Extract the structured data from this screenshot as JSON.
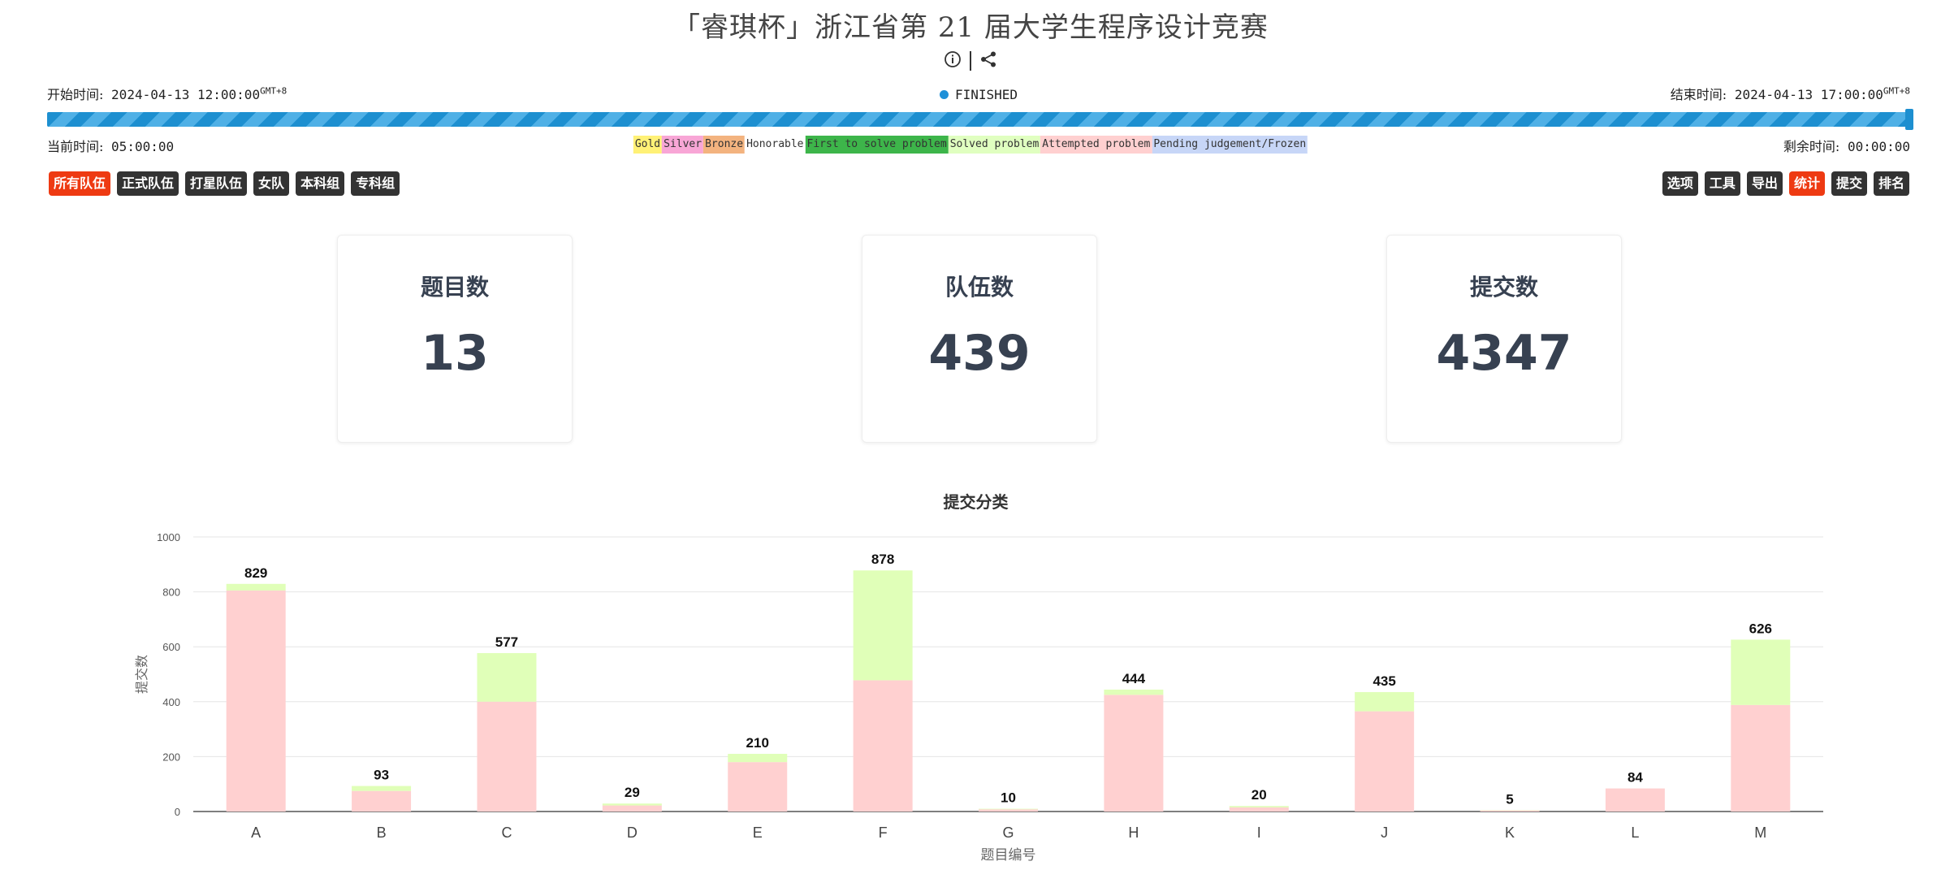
{
  "header": {
    "title": "「睿琪杯」浙江省第 21 届大学生程序设计竞赛",
    "info_icon": "info-circle-icon",
    "share_icon": "share-icon"
  },
  "times": {
    "start_label": "开始时间:",
    "start_value": "2024-04-13 12:00:00",
    "start_tz": "GMT+8",
    "end_label": "结束时间:",
    "end_value": "2024-04-13 17:00:00",
    "end_tz": "GMT+8",
    "status": "FINISHED",
    "current_label": "当前时间:",
    "current_value": "05:00:00",
    "remaining_label": "剩余时间:",
    "remaining_value": "00:00:00",
    "progress_fraction": 1.0
  },
  "legend": [
    {
      "label": "Gold",
      "color": "#fff176"
    },
    {
      "label": "Silver",
      "color": "#f8a6d6"
    },
    {
      "label": "Bronze",
      "color": "#f3b37f"
    },
    {
      "label": "Honorable",
      "color": "#ffffff"
    },
    {
      "label": "First to solve problem",
      "color": "#3db54a"
    },
    {
      "label": "Solved problem",
      "color": "#e0ffc0"
    },
    {
      "label": "Attempted problem",
      "color": "#ffd0d0"
    },
    {
      "label": "Pending judgement/Frozen",
      "color": "#c7d6f7"
    }
  ],
  "filters": [
    "所有队伍",
    "正式队伍",
    "打星队伍",
    "女队",
    "本科组",
    "专科组"
  ],
  "filters_active": 0,
  "tools": [
    "选项",
    "工具",
    "导出",
    "统计",
    "提交",
    "排名"
  ],
  "tools_active": 3,
  "stats": [
    {
      "label": "题目数",
      "value": "13"
    },
    {
      "label": "队伍数",
      "value": "439"
    },
    {
      "label": "提交数",
      "value": "4347"
    }
  ],
  "colors": {
    "accepted": "#e0ffb8",
    "rejected": "#ffd0d0",
    "active_button": "#ee3a12"
  },
  "chart_data": {
    "type": "bar",
    "title": "提交分类",
    "xlabel": "题目编号",
    "ylabel": "提交数",
    "ylim": [
      0,
      1000
    ],
    "yticks": [
      0,
      200,
      400,
      600,
      800,
      1000
    ],
    "categories": [
      "A",
      "B",
      "C",
      "D",
      "E",
      "F",
      "G",
      "H",
      "I",
      "J",
      "K",
      "L",
      "M"
    ],
    "totals": [
      829,
      93,
      577,
      29,
      210,
      878,
      10,
      444,
      20,
      435,
      5,
      84,
      626
    ],
    "series": [
      {
        "values": [
          805,
          75,
          400,
          22,
          180,
          478,
          8,
          425,
          15,
          365,
          4,
          84,
          388
        ]
      },
      {
        "values": [
          24,
          18,
          177,
          7,
          30,
          400,
          2,
          19,
          5,
          70,
          1,
          0,
          238
        ]
      }
    ],
    "stacked": true,
    "grid": true
  }
}
